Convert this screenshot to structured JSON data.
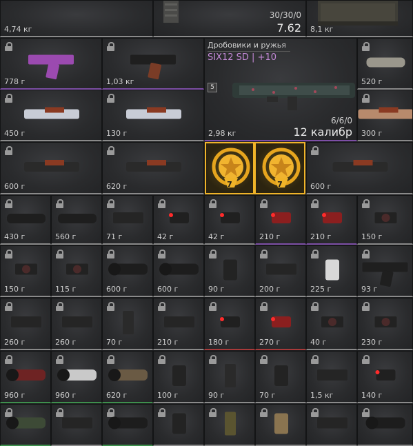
{
  "top_left": {
    "weight": "4,74 кг"
  },
  "top_middle": {
    "ammo": "30/30/0",
    "caliber": "7.62"
  },
  "top_right": {
    "weight": "8,1 кг"
  },
  "featured_weapon": {
    "category": "Дробовики и ружья",
    "name": "SIX12 SD | +10",
    "level": "5",
    "ammo": "6/6/0",
    "caliber": "12 калибр",
    "weight": "2,98 кг"
  },
  "badges": [
    {
      "number": "7"
    },
    {
      "number": "7"
    }
  ],
  "items": [
    {
      "weight": "778 г",
      "icon": "pistol-purple-icon",
      "color": "purple"
    },
    {
      "weight": "1,03 кг",
      "icon": "pistol-wood-icon",
      "color": "purple"
    },
    {
      "weight": "520 г",
      "icon": "suppressor-camo-icon",
      "color": "white"
    },
    {
      "weight": "450 г",
      "icon": "stock-winter-icon",
      "color": "white"
    },
    {
      "weight": "130 г",
      "icon": "stock-winter-short-icon",
      "color": "white"
    },
    {
      "weight": "300 г",
      "icon": "stock-desert-icon",
      "color": "white"
    },
    {
      "weight": "600 г",
      "icon": "stock-skeleton-icon",
      "color": "white"
    },
    {
      "weight": "620 г",
      "icon": "stock-tube-icon",
      "color": "white"
    },
    {
      "weight": "600 г",
      "icon": "stock-skeleton-2-icon",
      "color": "white"
    },
    {
      "weight": "430 г",
      "icon": "suppressor-icon",
      "color": "white"
    },
    {
      "weight": "560 г",
      "icon": "suppressor-long-icon",
      "color": "white"
    },
    {
      "weight": "71 г",
      "icon": "muzzle-brake-icon",
      "color": "white"
    },
    {
      "weight": "42 г",
      "icon": "laser-red-icon",
      "color": "white"
    },
    {
      "weight": "42 г",
      "icon": "laser-red-2-icon",
      "color": "white"
    },
    {
      "weight": "210 г",
      "icon": "laser-module-icon",
      "color": "purple"
    },
    {
      "weight": "210 г",
      "icon": "laser-module-red-icon",
      "color": "purple"
    },
    {
      "weight": "150 г",
      "icon": "red-dot-sight-icon",
      "color": "white"
    },
    {
      "weight": "150 г",
      "icon": "holo-sight-icon",
      "color": "white"
    },
    {
      "weight": "115 г",
      "icon": "holo-sight-2-icon",
      "color": "white"
    },
    {
      "weight": "600 г",
      "icon": "scope-icon",
      "color": "white"
    },
    {
      "weight": "600 г",
      "icon": "scope-2-icon",
      "color": "white"
    },
    {
      "weight": "90 г",
      "icon": "grip-icon",
      "color": "white"
    },
    {
      "weight": "200 г",
      "icon": "handguard-icon",
      "color": "white"
    },
    {
      "weight": "225 г",
      "icon": "grip-white-icon",
      "color": "white"
    },
    {
      "weight": "93 г",
      "icon": "pistol-grip-icon",
      "color": "white"
    },
    {
      "weight": "260 г",
      "icon": "mount-icon",
      "color": "white"
    },
    {
      "weight": "260 г",
      "icon": "mount-2-icon",
      "color": "white"
    },
    {
      "weight": "70 г",
      "icon": "magazine-icon",
      "color": "white"
    },
    {
      "weight": "210 г",
      "icon": "rail-cover-icon",
      "color": "white"
    },
    {
      "weight": "180 г",
      "icon": "laser-blue-red-icon",
      "color": "red"
    },
    {
      "weight": "270 г",
      "icon": "laser-red-module-icon",
      "color": "red"
    },
    {
      "weight": "40 г",
      "icon": "collimator-icon",
      "color": "white"
    },
    {
      "weight": "230 г",
      "icon": "reflex-sight-icon",
      "color": "white"
    },
    {
      "weight": "960 г",
      "icon": "scope-red-camo-icon",
      "color": "green"
    },
    {
      "weight": "960 г",
      "icon": "scope-white-icon",
      "color": "green"
    },
    {
      "weight": "620 г",
      "icon": "scope-tan-icon",
      "color": "green"
    },
    {
      "weight": "100 г",
      "icon": "foregrip-icon",
      "color": "white"
    },
    {
      "weight": "90 г",
      "icon": "magazine-drum-icon",
      "color": "white"
    },
    {
      "weight": "70 г",
      "icon": "angled-grip-icon",
      "color": "white"
    },
    {
      "weight": "1,5 кг",
      "icon": "night-vision-icon",
      "color": "white"
    },
    {
      "weight": "140 г",
      "icon": "laser-cylinder-icon",
      "color": "white"
    },
    {
      "weight": "",
      "icon": "scope-green-icon",
      "color": "green"
    },
    {
      "weight": "",
      "icon": "bipod-icon",
      "color": "white"
    },
    {
      "weight": "",
      "icon": "scope-digital-icon",
      "color": "green"
    },
    {
      "weight": "",
      "icon": "foregrip-2-icon",
      "color": "white"
    },
    {
      "weight": "",
      "icon": "magazine-green-icon",
      "color": "white"
    },
    {
      "weight": "",
      "icon": "grip-tan-icon",
      "color": "white"
    },
    {
      "weight": "",
      "icon": "mount-3-icon",
      "color": "white"
    },
    {
      "weight": "",
      "icon": "scope-3-icon",
      "color": "white"
    }
  ]
}
